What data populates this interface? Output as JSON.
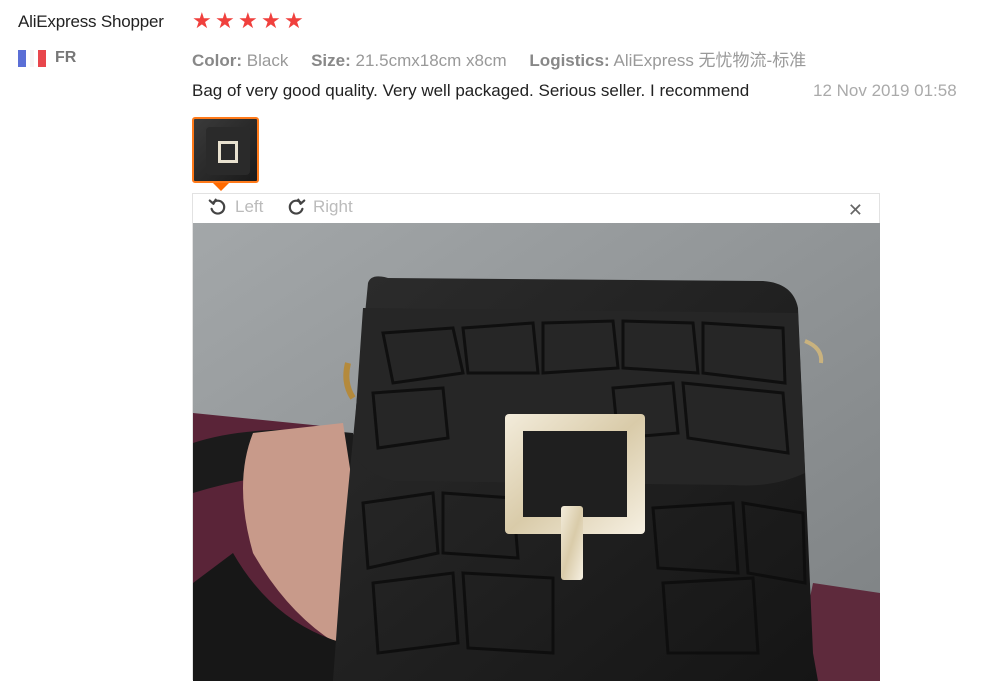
{
  "review": {
    "reviewer_name": "AliExpress Shopper",
    "rating": 5,
    "country_code": "FR",
    "attributes": [
      {
        "key": "Color:",
        "value": "Black"
      },
      {
        "key": "Size:",
        "value": "21.5cmx18cm x8cm"
      },
      {
        "key": "Logistics:",
        "value": "AliExpress 无忧物流-标准"
      }
    ],
    "text": "Bag of very good quality. Very well packaged. Serious seller. I recommend",
    "date": "12 Nov 2019 01:58"
  },
  "viewer": {
    "rotate_left_label": "Left",
    "rotate_right_label": "Right",
    "close_symbol": "✕"
  },
  "icons": {
    "star": "★",
    "rotate_left": "rotate-left-icon",
    "rotate_right": "rotate-right-icon",
    "close": "close-icon"
  },
  "colors": {
    "star": "#f0403d",
    "thumb_border": "#ff7a1a",
    "flag_blue": "#5b6fd6",
    "flag_red": "#e8464c"
  }
}
